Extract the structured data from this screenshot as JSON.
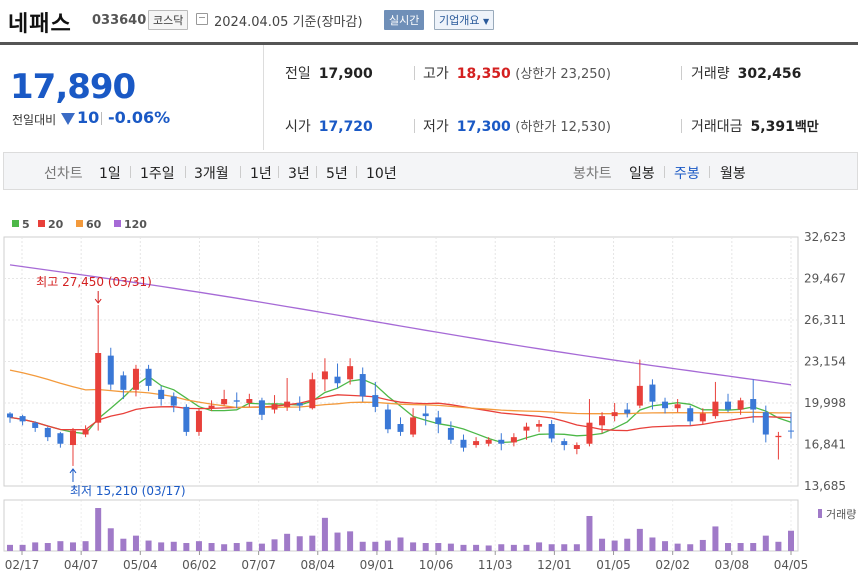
{
  "header": {
    "name": "네패스",
    "code": "033640",
    "market": "코스닥",
    "date": "2024.04.05",
    "basis": "기준(장마감)",
    "realtime_button": "실시간",
    "company_button": "기업개요"
  },
  "price": {
    "current": "17,890",
    "change_label": "전일대비",
    "change_value": "10",
    "change_pct": "-0.06%",
    "direction": "down"
  },
  "stats": {
    "prev_label": "전일",
    "prev_value": "17,900",
    "high_label": "고가",
    "high_value": "18,350",
    "high_limit": "(상한가 23,250)",
    "volume_label": "거래량",
    "volume_value": "302,456",
    "open_label": "시가",
    "open_value": "17,720",
    "low_label": "저가",
    "low_value": "17,300",
    "low_limit": "(하한가 12,530)",
    "amount_label": "거래대금",
    "amount_value": "5,391",
    "amount_unit": "백만"
  },
  "toolbar": {
    "line_label": "선차트",
    "periods": [
      "1일",
      "1주일",
      "3개월",
      "1년",
      "3년",
      "5년",
      "10년"
    ],
    "candle_label": "봉차트",
    "candle_types": [
      "일봉",
      "주봉",
      "월봉"
    ],
    "active_candle": "주봉"
  },
  "chart_data": {
    "type": "candlestick",
    "legend": [
      {
        "name": "5",
        "color": "#4db848"
      },
      {
        "name": "20",
        "color": "#e8403a"
      },
      {
        "name": "60",
        "color": "#f39a3c"
      },
      {
        "name": "120",
        "color": "#a66ad6"
      }
    ],
    "y_ticks": [
      "32,623",
      "29,467",
      "26,311",
      "23,154",
      "19,998",
      "16,841",
      "13,685"
    ],
    "y_tick_values": [
      32623,
      29467,
      26311,
      23154,
      19998,
      16841,
      13685
    ],
    "x_ticks": [
      "02/17",
      "04/07",
      "05/04",
      "06/02",
      "07/07",
      "08/04",
      "09/01",
      "10/06",
      "11/03",
      "12/01",
      "01/05",
      "02/02",
      "03/08",
      "04/05"
    ],
    "max_annotation": "최고 27,450 (03/31)",
    "min_annotation": "최저 15,210 (03/17)",
    "volume_label": "거래량",
    "up_color": "#e8403a",
    "down_color": "#3a78d6",
    "candles": [
      [
        19200,
        19300,
        18900,
        18500
      ],
      [
        19000,
        19100,
        18600,
        18300
      ],
      [
        18500,
        18600,
        18100,
        17800
      ],
      [
        18100,
        18200,
        17400,
        17100
      ],
      [
        17700,
        17800,
        16900,
        16600
      ],
      [
        16800,
        18100,
        17900,
        15210
      ],
      [
        17600,
        18300,
        18000,
        17400
      ],
      [
        18500,
        27450,
        23800,
        17900
      ],
      [
        23600,
        24200,
        21400,
        21000
      ],
      [
        22100,
        22400,
        21000,
        20300
      ],
      [
        21000,
        22900,
        22600,
        20500
      ],
      [
        22600,
        22900,
        21300,
        20900
      ],
      [
        21000,
        21300,
        20300,
        19800
      ],
      [
        20500,
        20800,
        19800,
        19300
      ],
      [
        19700,
        19900,
        17800,
        17500
      ],
      [
        17800,
        19600,
        19400,
        17500
      ],
      [
        19600,
        20200,
        19800,
        19400
      ],
      [
        19900,
        21000,
        20300,
        19800
      ],
      [
        20200,
        20800,
        20100,
        19600
      ],
      [
        20000,
        20700,
        20300,
        19700
      ],
      [
        20200,
        20400,
        19100,
        18700
      ],
      [
        19500,
        20600,
        19900,
        19200
      ],
      [
        19700,
        21900,
        20100,
        19400
      ],
      [
        20000,
        20500,
        19800,
        19400
      ],
      [
        19600,
        22300,
        21800,
        19500
      ],
      [
        21800,
        23400,
        22400,
        20900
      ],
      [
        22000,
        23000,
        21500,
        21100
      ],
      [
        21800,
        23400,
        22800,
        21400
      ],
      [
        22200,
        22700,
        20500,
        20100
      ],
      [
        20600,
        21600,
        19700,
        19300
      ],
      [
        19500,
        19900,
        18000,
        17700
      ],
      [
        18400,
        18900,
        17800,
        17500
      ],
      [
        17600,
        19600,
        18900,
        17400
      ],
      [
        19200,
        19800,
        19000,
        18300
      ],
      [
        18900,
        19400,
        18400,
        17700
      ],
      [
        18100,
        18600,
        17200,
        16900
      ],
      [
        17200,
        17600,
        16600,
        16300
      ],
      [
        16800,
        17400,
        17100,
        16600
      ],
      [
        16900,
        17400,
        17200,
        16700
      ],
      [
        17200,
        17700,
        16900,
        16400
      ],
      [
        17000,
        17700,
        17400,
        16700
      ],
      [
        17900,
        18500,
        18200,
        17200
      ],
      [
        18200,
        18700,
        18400,
        17800
      ],
      [
        18400,
        18700,
        17300,
        17000
      ],
      [
        17100,
        17300,
        16800,
        16400
      ],
      [
        16500,
        17000,
        16800,
        16100
      ],
      [
        16900,
        20300,
        18500,
        16700
      ],
      [
        18300,
        19300,
        19000,
        17700
      ],
      [
        19000,
        20000,
        19300,
        18600
      ],
      [
        19500,
        20000,
        19200,
        18900
      ],
      [
        19800,
        23300,
        21300,
        19600
      ],
      [
        21400,
        21800,
        20100,
        19500
      ],
      [
        20100,
        20400,
        19600,
        19200
      ],
      [
        19600,
        20300,
        19900,
        19300
      ],
      [
        19600,
        19800,
        18600,
        18300
      ],
      [
        18600,
        19600,
        19200,
        18400
      ],
      [
        19000,
        21600,
        20100,
        18800
      ],
      [
        20100,
        20700,
        19500,
        19300
      ],
      [
        19500,
        20400,
        20200,
        19100
      ],
      [
        20300,
        21800,
        19500,
        18500
      ],
      [
        19300,
        19800,
        17600,
        17000
      ],
      [
        17400,
        17800,
        17500,
        15700
      ],
      [
        17900,
        19300,
        17890,
        17300
      ]
    ],
    "volumes": [
      1.0,
      1.0,
      1.4,
      1.3,
      1.6,
      1.4,
      1.6,
      7.0,
      3.7,
      2.0,
      2.5,
      1.7,
      1.4,
      1.5,
      1.3,
      1.6,
      1.3,
      1.1,
      1.3,
      1.5,
      1.2,
      1.9,
      2.8,
      2.4,
      2.5,
      5.4,
      3.0,
      3.2,
      1.5,
      1.5,
      1.7,
      2.2,
      1.4,
      1.3,
      1.3,
      1.2,
      1.0,
      1.0,
      0.9,
      1.1,
      1.0,
      1.0,
      1.4,
      1.1,
      1.1,
      1.1,
      5.7,
      2.0,
      1.7,
      2.0,
      3.6,
      2.2,
      1.6,
      1.2,
      1.1,
      1.8,
      4.0,
      1.3,
      1.3,
      1.3,
      2.5,
      1.5,
      3.3
    ]
  }
}
